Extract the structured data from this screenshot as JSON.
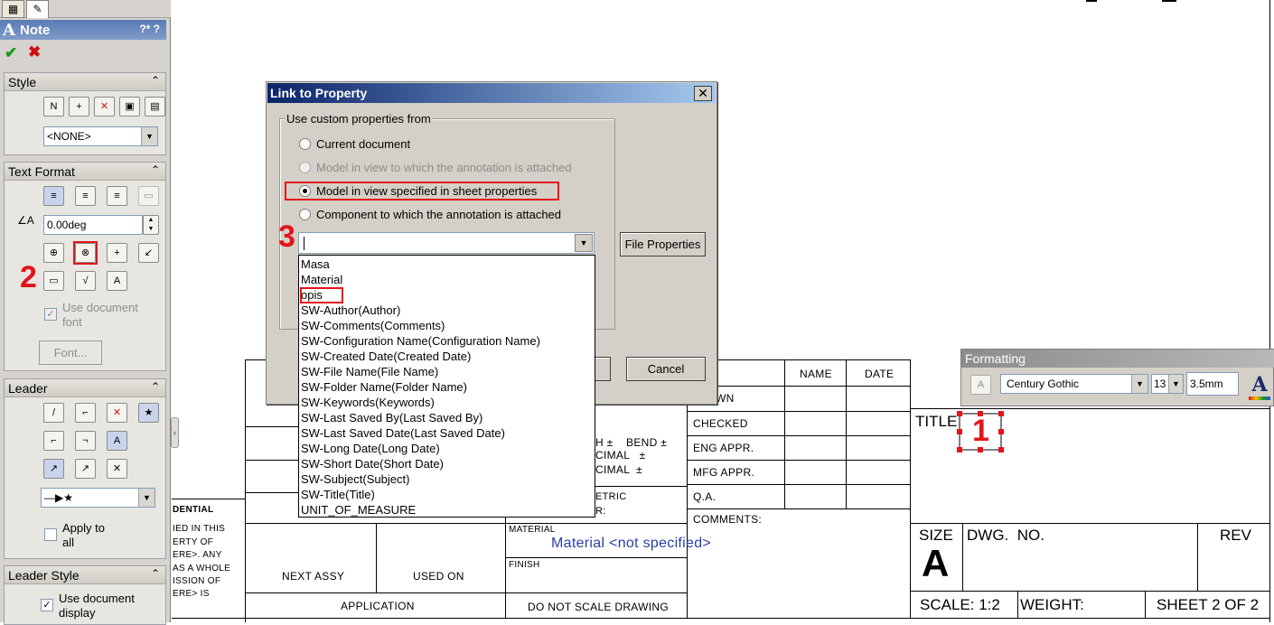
{
  "property_manager": {
    "title": "Note",
    "help_icons": "?* ?",
    "style": {
      "header": "Style",
      "select_value": "<NONE>"
    },
    "text_format": {
      "header": "Text Format",
      "angle_value": "0.00deg",
      "use_document_font": "Use document font",
      "font_button": "Font..."
    },
    "leader": {
      "header": "Leader",
      "apply_to_all": "Apply to all"
    },
    "leader_style": {
      "header": "Leader Style",
      "use_document_display": "Use document display"
    }
  },
  "annotations": {
    "n1": "1",
    "n2": "2",
    "n3": "3"
  },
  "dialog": {
    "title": "Link to Property",
    "group_label": "Use custom properties from",
    "options": [
      {
        "label": "Current document",
        "selected": false,
        "enabled": true
      },
      {
        "label": "Model in view to which the annotation is attached",
        "selected": false,
        "enabled": false
      },
      {
        "label": "Model in view specified in sheet properties",
        "selected": true,
        "enabled": true
      },
      {
        "label": "Component to which the annotation is attached",
        "selected": false,
        "enabled": true
      }
    ],
    "combo_value": "",
    "file_properties_button": "File Properties",
    "cancel_button": "Cancel",
    "dropdown_items": [
      "Masa",
      "Material",
      "opis",
      "SW-Author(Author)",
      "SW-Comments(Comments)",
      "SW-Configuration Name(Configuration Name)",
      "SW-Created Date(Created Date)",
      "SW-File Name(File Name)",
      "SW-Folder Name(Folder Name)",
      "SW-Keywords(Keywords)",
      "SW-Last Saved By(Last Saved By)",
      "SW-Last Saved Date(Last Saved Date)",
      "SW-Long Date(Long Date)",
      "SW-Short Date(Short Date)",
      "SW-Subject(Subject)",
      "SW-Title(Title)",
      "UNIT_OF_MEASURE"
    ]
  },
  "formatting_toolbar": {
    "title": "Formatting",
    "font": "Century Gothic",
    "size": "13",
    "height": "3.5mm"
  },
  "title_block": {
    "name": "NAME",
    "date": "DATE",
    "drawn": "WN",
    "checked": "CHECKED",
    "eng_appr": "ENG APPR.",
    "mfg_appr": "MFG APPR.",
    "qa": "Q.A.",
    "comments": "COMMENTS:",
    "title": "TITLE:",
    "size_label": "SIZE",
    "size_value": "A",
    "dwg_no": "DWG.  NO.",
    "rev": "REV",
    "scale": "SCALE: 1:2",
    "weight": "WEIGHT:",
    "sheet": "SHEET 2 OF 2",
    "tol_1": "H ±    BEND ±",
    "tol_2": "CIMAL   ±",
    "tol_3": "CIMAL  ±",
    "etric": "ETRIC",
    "r": "R:",
    "material_label": "MATERIAL",
    "material_value": "Material <not specified>",
    "finish": "FINISH",
    "next_assy": "NEXT ASSY",
    "used_on": "USED ON",
    "application": "APPLICATION",
    "do_not_scale": "DO NOT SCALE DRAWING",
    "confidential": "DENTIAL",
    "conf_lines": [
      "IED IN THIS",
      "ERTY OF",
      "ERE>. ANY",
      "AS A WHOLE",
      "ISSION OF",
      "ERE> IS"
    ]
  }
}
